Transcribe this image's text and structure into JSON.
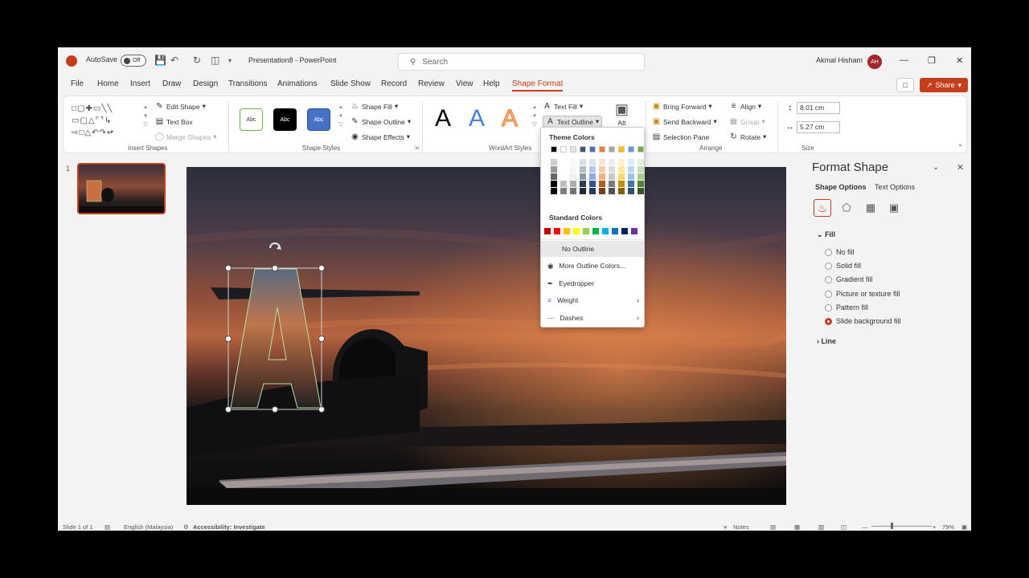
{
  "titlebar": {
    "autosave_label": "AutoSave",
    "autosave_state": "Off",
    "doc_title": "Presentation8 - PowerPoint",
    "search_placeholder": "Search",
    "user_name": "Akmal Hisham",
    "user_initials": "AH"
  },
  "menu": [
    "File",
    "Home",
    "Insert",
    "Draw",
    "Design",
    "Transitions",
    "Animations",
    "Slide Show",
    "Record",
    "Review",
    "View",
    "Help",
    "Shape Format"
  ],
  "menu_active": "Shape Format",
  "share_label": "Share",
  "ribbon": {
    "edit_shape": "Edit Shape",
    "text_box": "Text Box",
    "merge_shapes": "Merge Shapes",
    "insert_shapes_label": "Insert Shapes",
    "style_abc": "Abc",
    "shape_fill": "Shape Fill",
    "shape_outline": "Shape Outline",
    "shape_effects": "Shape Effects",
    "shape_styles_label": "Shape Styles",
    "wordart_letter": "A",
    "text_fill": "Text Fill",
    "text_outline": "Text Outline",
    "wordart_styles_label": "WordArt Styles",
    "alt_label": "Alt",
    "bring_forward": "Bring Forward",
    "send_backward": "Send Backward",
    "selection_pane": "Selection Pane",
    "align": "Align",
    "group": "Group",
    "rotate": "Rotate",
    "arrange_label": "Arrange",
    "height": "8.01 cm",
    "width": "5.27 cm",
    "size_label": "Size"
  },
  "thumbnail": {
    "number": "1"
  },
  "dropdown": {
    "theme_colors_label": "Theme Colors",
    "standard_colors_label": "Standard Colors",
    "theme_top_row": [
      "#000000",
      "#ffffff",
      "#e7e6e6",
      "#44546a",
      "#4472c4",
      "#ed7d31",
      "#a5a5a5",
      "#ffc000",
      "#5b9bd5",
      "#70ad47"
    ],
    "standard_colors": [
      "#c00000",
      "#ff0000",
      "#ffc000",
      "#ffff00",
      "#92d050",
      "#00b050",
      "#00b0f0",
      "#0070c0",
      "#002060",
      "#7030a0"
    ],
    "no_outline": "No Outline",
    "more_colors": "More Outline Colors...",
    "eyedropper": "Eyedropper",
    "weight": "Weight",
    "dashes": "Dashes"
  },
  "format_pane": {
    "title": "Format Shape",
    "tab_shape": "Shape Options",
    "tab_text": "Text Options",
    "fill_section": "Fill",
    "fill_options": [
      "No fill",
      "Solid fill",
      "Gradient fill",
      "Picture or texture fill",
      "Pattern fill",
      "Slide background fill"
    ],
    "fill_selected": "Slide background fill",
    "line_section": "Line"
  },
  "status": {
    "slide_info": "Slide 1 of 1",
    "language": "English (Malaysia)",
    "accessibility": "Accessibility: Investigate",
    "notes": "Notes",
    "zoom": "79%"
  }
}
